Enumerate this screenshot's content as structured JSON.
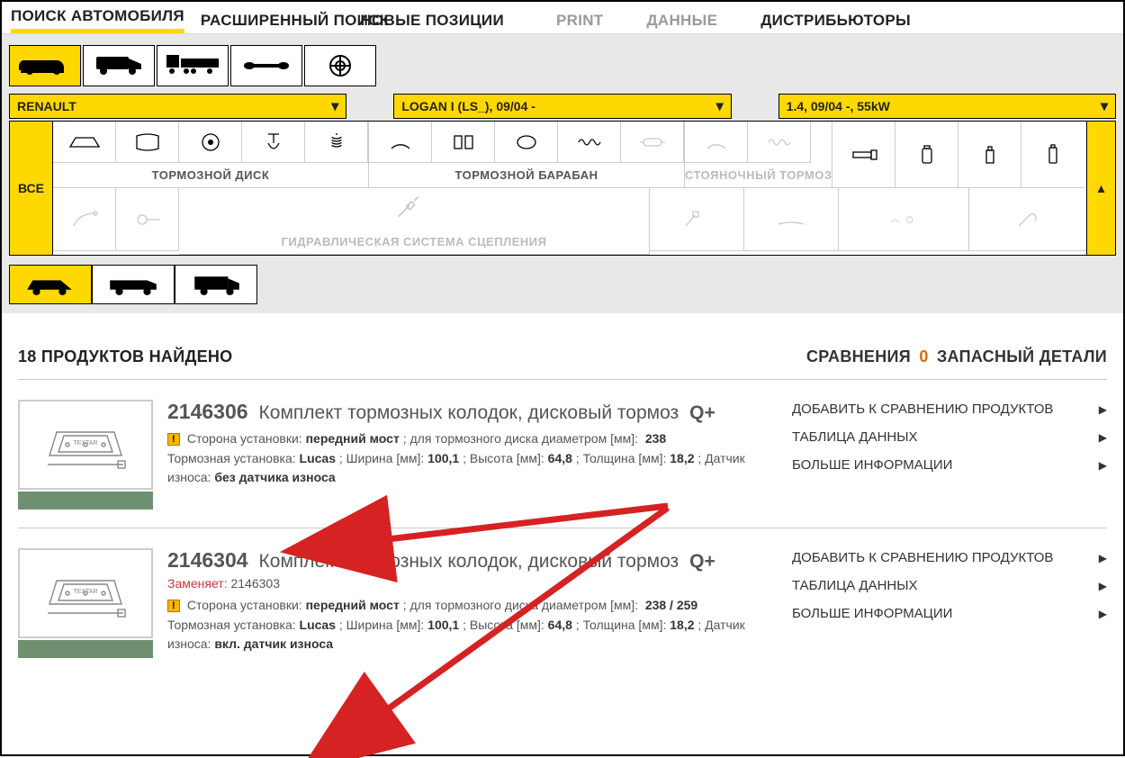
{
  "nav": {
    "vehicle_search": "ПОИСК АВТОМОБИЛЯ",
    "adv_search": "РАСШИРЕННЫЙ ПОИСК",
    "new_items": "НОВЫЕ ПОЗИЦИИ",
    "print": "PRINT",
    "data": "ДАННЫЕ",
    "distrib": "ДИСТРИБЬЮТОРЫ"
  },
  "selects": {
    "make": "RENAULT",
    "model": "LOGAN I (LS_), 09/04 -",
    "engine": "1.4, 09/04 -, 55kW"
  },
  "catAll": "ВСЕ",
  "groups": {
    "disc": "ТОРМОЗНОЙ ДИСК",
    "drum": "ТОРМОЗНОЙ БАРАБАН",
    "park": "СТОЯНОЧНЫЙ ТОРМОЗ",
    "hydr": "ГИДРАВЛИЧЕСКАЯ СИСТЕМА СЦЕПЛЕНИЯ"
  },
  "results": {
    "count_label": "18 ПРОДУКТОВ НАЙДЕНО",
    "compare_label_a": "СРАВНЕНИЯ",
    "compare_count": "0",
    "compare_label_b": "ЗАПАСНЫЙ ДЕТАЛИ"
  },
  "actions": {
    "compare": "ДОБАВИТЬ К СРАВНЕНИЮ ПРОДУКТОВ",
    "datatable": "ТАБЛИЦА ДАННЫХ",
    "more": "БОЛЬШЕ ИНФОРМАЦИИ"
  },
  "p1": {
    "sku": "2146306",
    "name": "Комплект тормозных колодок, дисковый тормоз",
    "q": "Q+",
    "side_lbl": "Сторона установки:",
    "side_val": "передний мост",
    "diam_lbl": "; для тормозного диска диаметром [мм]:",
    "diam_val": "238",
    "brake_lbl": "Тормозная установка:",
    "brake_val": "Lucas",
    "w_lbl": "; Ширина [мм]:",
    "w_val": "100,1",
    "h_lbl": "; Высота [мм]:",
    "h_val": "64,8",
    "t_lbl": "; Толщина [мм]:",
    "t_val": "18,2",
    "sens_lbl": "; Датчик износа:",
    "sens_val": "без датчика износа"
  },
  "p2": {
    "sku": "2146304",
    "name": "Комплект тормозных колодок, дисковый тормоз",
    "q": "Q+",
    "repl_lbl": "Заменяет:",
    "repl_val": "2146303",
    "side_lbl": "Сторона установки:",
    "side_val": "передний мост",
    "diam_lbl": "; для тормозного диска диаметром [мм]:",
    "diam_val": "238 /  259",
    "brake_lbl": "Тормозная установка:",
    "brake_val": "Lucas",
    "w_lbl": "; Ширина [мм]:",
    "w_val": "100,1",
    "h_lbl": "; Высота [мм]:",
    "h_val": "64,8",
    "t_lbl": "; Толщина [мм]:",
    "t_val": "18,2",
    "sens_lbl": "; Датчик износа:",
    "sens_val": "вкл. датчик износа"
  }
}
